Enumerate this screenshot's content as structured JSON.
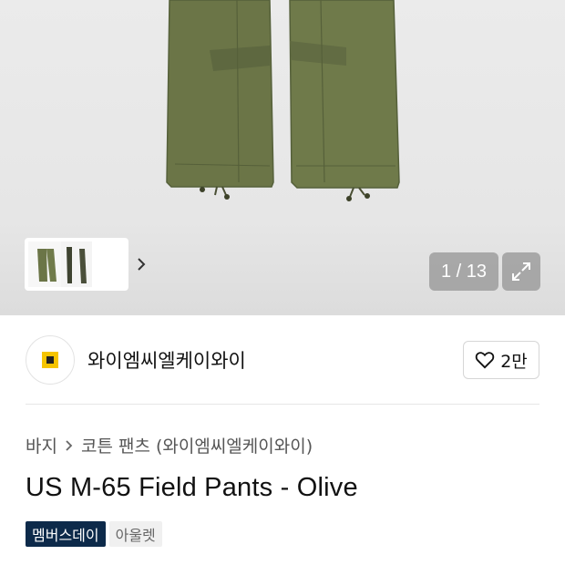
{
  "gallery": {
    "counter": "1 / 13",
    "thumb_next_icon": "chevron-right-icon",
    "expand_icon": "expand-icon",
    "product_color": "#6b7547"
  },
  "brand": {
    "name": "와이엠씨엘케이와이",
    "logo_icon": "brand-logo",
    "logo_color": "#f5c400",
    "like_icon": "heart-outline-icon",
    "like_count": "2만"
  },
  "breadcrumb": {
    "items": [
      "바지",
      "코튼 팬츠 (와이엠씨엘케이와이)"
    ],
    "separator_icon": "chevron-right-icon"
  },
  "product": {
    "title": "US M-65 Field Pants - Olive"
  },
  "badges": [
    {
      "label": "멤버스데이",
      "color": "#0d2a4a"
    },
    {
      "label": "아울렛",
      "color": "#f0f0f0"
    }
  ]
}
